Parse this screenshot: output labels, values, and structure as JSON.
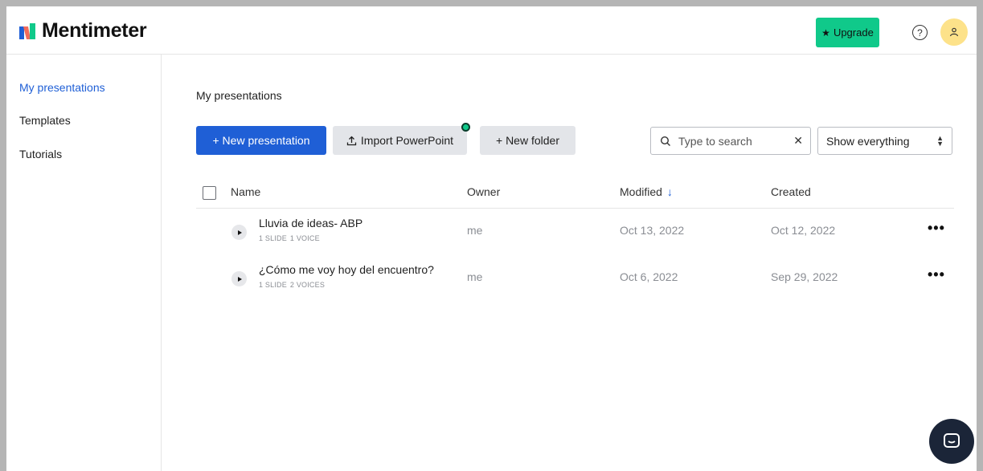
{
  "header": {
    "logo_text": "Mentimeter",
    "upgrade_label": "Upgrade",
    "brand_colors": {
      "blue": "#1f5fd6",
      "green": "#10c98a",
      "yellow": "#fde28a"
    }
  },
  "sidebar": {
    "items": [
      {
        "label": "My presentations",
        "active": true
      },
      {
        "label": "Templates",
        "active": false
      },
      {
        "label": "Tutorials",
        "active": false
      }
    ]
  },
  "main": {
    "title": "My presentations",
    "buttons": {
      "new_presentation": "+ New presentation",
      "import_powerpoint": "Import PowerPoint",
      "new_folder": "+ New folder"
    },
    "search": {
      "placeholder": "Type to search",
      "value": ""
    },
    "filter": {
      "selected": "Show everything"
    },
    "table": {
      "headers": {
        "name": "Name",
        "owner": "Owner",
        "modified": "Modified",
        "created": "Created"
      },
      "rows": [
        {
          "title": "Lluvia de ideas- ABP",
          "slides": "1 SLIDE",
          "voices": "1 VOICE",
          "owner": "me",
          "modified": "Oct 13, 2022",
          "created": "Oct 12, 2022"
        },
        {
          "title": "¿Cómo me voy hoy del encuentro?",
          "slides": "1 SLIDE",
          "voices": "2 VOICES",
          "owner": "me",
          "modified": "Oct 6, 2022",
          "created": "Sep 29, 2022"
        }
      ]
    }
  },
  "icons": [
    "logo-mark-icon",
    "star-icon",
    "help-icon",
    "avatar-user-icon",
    "upload-icon",
    "search-icon",
    "clear-icon",
    "select-arrows-icon",
    "sort-down-icon",
    "play-icon",
    "more-icon",
    "chat-icon"
  ]
}
